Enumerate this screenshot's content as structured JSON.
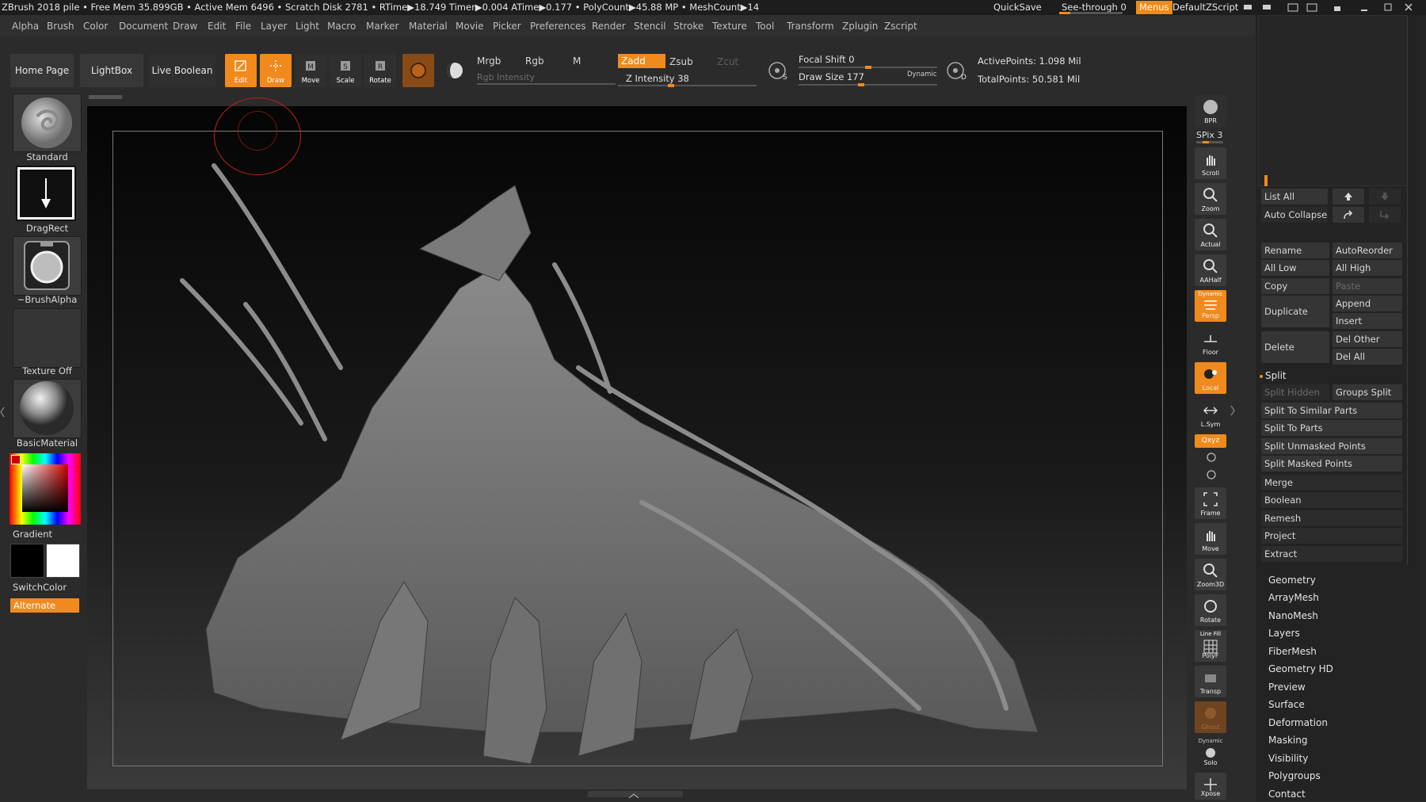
{
  "titlebar": {
    "info": "ZBrush 2018   pile   • Free Mem 35.899GB • Active Mem 6496 • Scratch Disk 2781 •  RTime▶18.749 Timer▶0.004 ATime▶0.177 • PolyCount▶45.88 MP • MeshCount▶14",
    "quicksave": "QuickSave",
    "seethrough": "See-through  0",
    "menus": "Menus",
    "script": "DefaultZScript"
  },
  "menubar": [
    "Alpha",
    "Brush",
    "Color",
    "Document",
    "Draw",
    "Edit",
    "File",
    "Layer",
    "Light",
    "Macro",
    "Marker",
    "Material",
    "Movie",
    "Picker",
    "Preferences",
    "Render",
    "Stencil",
    "Stroke",
    "Texture",
    "Tool",
    "Transform",
    "Zplugin",
    "Zscript"
  ],
  "toolbar": {
    "home": "Home Page",
    "lightbox": "LightBox",
    "liveboolean": "Live Boolean",
    "edit": "Edit",
    "draw": "Draw",
    "move": "Move",
    "scale": "Scale",
    "rotate": "Rotate",
    "mrgb": "Mrgb",
    "rgb": "Rgb",
    "m": "M",
    "rgb_intensity": "Rgb Intensity",
    "zadd": "Zadd",
    "zsub": "Zsub",
    "zcut": "Zcut",
    "z_intensity": "Z Intensity 38",
    "focal_shift": "Focal Shift 0",
    "draw_size": "Draw Size 177",
    "dynamic": "Dynamic",
    "active_points": "ActivePoints: 1.098 Mil",
    "total_points": "TotalPoints: 50.581 Mil",
    "z_intensity_level": 0.38,
    "focal_shift_level": 0.5,
    "draw_size_level": 0.45
  },
  "lefttray": {
    "brush": "Standard",
    "stroke": "DragRect",
    "alpha": "~BrushAlpha",
    "texture": "Texture Off",
    "material": "BasicMaterial",
    "gradient": "Gradient",
    "switchcolor": "SwitchColor",
    "alternate": "Alternate"
  },
  "shelf": {
    "bpr": "BPR",
    "spix": "SPix 3",
    "scroll": "Scroll",
    "zoom": "Zoom",
    "actual": "Actual",
    "aahalf": "AAHalf",
    "persp_top": "Dynamic",
    "persp": "Persp",
    "floor": "Floor",
    "local": "Local",
    "lsym": "L.Sym",
    "xyz": "Qxyz",
    "frame": "Frame",
    "move": "Move",
    "zoom3d": "Zoom3D",
    "rotate": "Rotate",
    "linefill_top": "Line Fill",
    "polyf": "PolyF",
    "transp": "Transp",
    "ghost": "Ghost",
    "solo_top": "Dynamic",
    "solo": "Solo",
    "xpose": "Xpose"
  },
  "subtool": {
    "list_all": "List All",
    "auto_collapse": "Auto Collapse",
    "rename": "Rename",
    "autoreorder": "AutoReorder",
    "all_low": "All Low",
    "all_high": "All High",
    "copy": "Copy",
    "paste": "Paste",
    "duplicate": "Duplicate",
    "append": "Append",
    "insert": "Insert",
    "delete": "Delete",
    "del_other": "Del Other",
    "del_all": "Del All",
    "split": "Split",
    "split_hidden": "Split Hidden",
    "groups_split": "Groups Split",
    "split_similar": "Split To Similar Parts",
    "split_parts": "Split To Parts",
    "split_unmasked": "Split Unmasked Points",
    "split_masked": "Split Masked Points",
    "merge": "Merge",
    "boolean": "Boolean",
    "remesh": "Remesh",
    "project": "Project",
    "extract": "Extract"
  },
  "sections": [
    "Geometry",
    "ArrayMesh",
    "NanoMesh",
    "Layers",
    "FiberMesh",
    "Geometry HD",
    "Preview",
    "Surface",
    "Deformation",
    "Masking",
    "Visibility",
    "Polygroups",
    "Contact"
  ],
  "colors": {
    "accent": "#f08a1c"
  }
}
